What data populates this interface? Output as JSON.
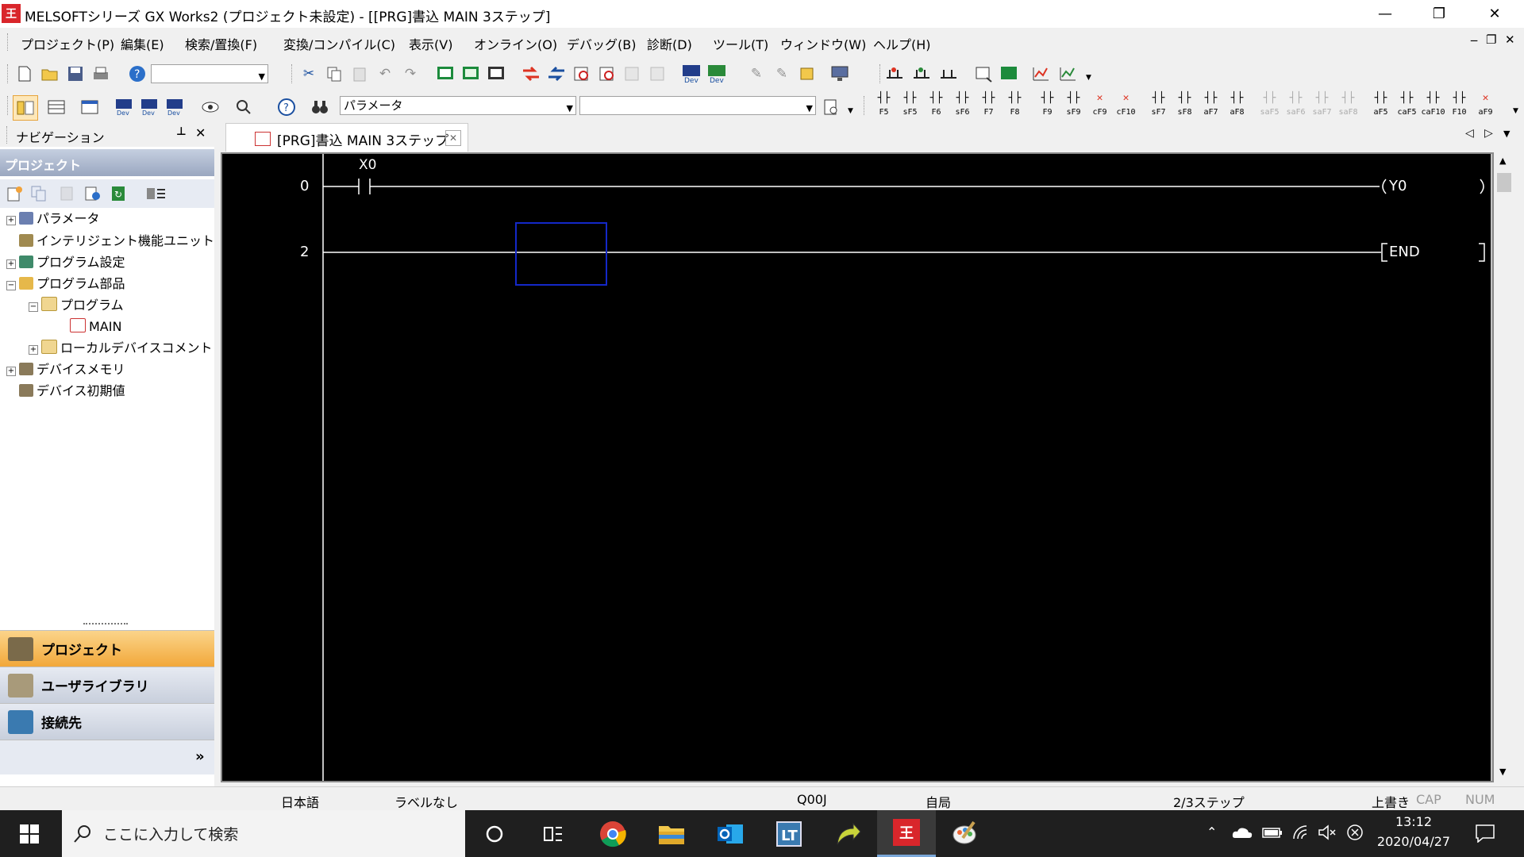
{
  "window": {
    "title": "MELSOFTシリーズ GX Works2 (プロジェクト未設定) - [[PRG]書込 MAIN 3ステップ]",
    "logo": "王",
    "minimize": "—",
    "restore": "❐",
    "close": "✕"
  },
  "menu": {
    "items": [
      "プロジェクト(P)",
      "編集(E)",
      "検索/置換(F)",
      "変換/コンパイル(C)",
      "表示(V)",
      "オンライン(O)",
      "デバッグ(B)",
      "診断(D)",
      "ツール(T)",
      "ウィンドウ(W)",
      "ヘルプ(H)"
    ],
    "mdi_min": "‒",
    "mdi_restore": "❐",
    "mdi_close": "✕"
  },
  "toolbar2": {
    "combo_parameter": "パラメータ"
  },
  "ladder_keys": [
    "F5",
    "sF5",
    "F6",
    "sF6",
    "F7",
    "F8",
    "F9",
    "sF9",
    "cF9",
    "cF10",
    "sF7",
    "sF8",
    "aF7",
    "aF8",
    "saF5",
    "saF6",
    "saF7",
    "saF8",
    "aF5",
    "caF5",
    "caF10",
    "F10",
    "aF9"
  ],
  "navigation": {
    "title": "ナビゲーション",
    "pin": "⊥",
    "close": "✕",
    "project_header": "プロジェクト",
    "tree": [
      {
        "label": "パラメータ"
      },
      {
        "label": "インテリジェント機能ユニット"
      },
      {
        "label": "プログラム設定"
      },
      {
        "label": "プログラム部品"
      },
      {
        "label": "プログラム"
      },
      {
        "label": "MAIN"
      },
      {
        "label": "ローカルデバイスコメント"
      },
      {
        "label": "デバイスメモリ"
      },
      {
        "label": "デバイス初期値"
      }
    ],
    "buttons": [
      "プロジェクト",
      "ユーザライブラリ",
      "接続先"
    ],
    "more": "»"
  },
  "editor": {
    "tab_label": "[PRG]書込 MAIN 3ステップ",
    "tab_close": "✕",
    "rungs": [
      {
        "step": "0",
        "contact": "X0",
        "coil": "Y0"
      },
      {
        "step": "2",
        "instruction": "END"
      }
    ]
  },
  "statusbar": {
    "language": "日本語",
    "label": "ラベルなし",
    "cpu": "Q00J",
    "station": "自局",
    "steps": "2/3ステップ",
    "mode": "上書き",
    "cap": "CAP",
    "num": "NUM"
  },
  "taskbar": {
    "search_placeholder": "ここに入力して検索",
    "time": "13:12",
    "date": "2020/04/27"
  }
}
